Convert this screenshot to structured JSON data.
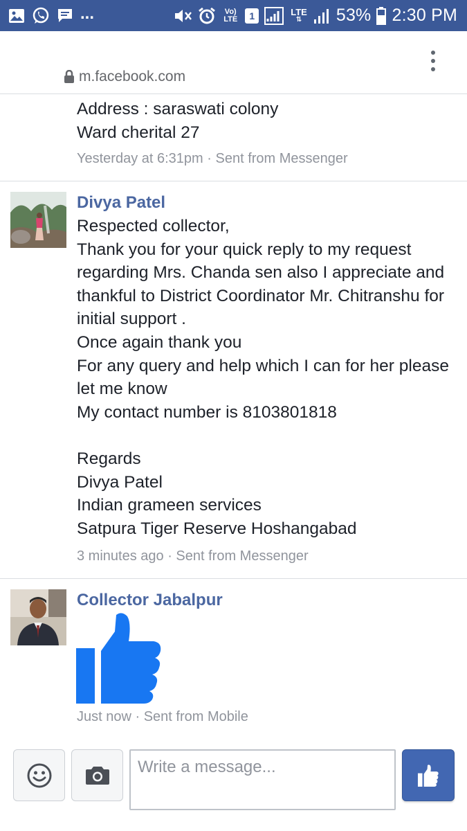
{
  "status_bar": {
    "network_small": "Vo) LTE",
    "sim_slot": "1",
    "lte": "LTE",
    "battery": "53%",
    "time": "2:30 PM"
  },
  "browser": {
    "url": "m.facebook.com"
  },
  "conversation": {
    "messages": [
      {
        "lines": [
          "Address : saraswati colony",
          "Ward cherital 27"
        ],
        "meta": "Yesterday at 6:31pm · Sent from Messenger"
      },
      {
        "sender": "Divya Patel",
        "lines": [
          "Respected collector,",
          "Thank you for your quick reply to my request regarding Mrs. Chanda sen also I appreciate and thankful to District Coordinator Mr. Chitranshu for initial support .",
          "Once again thank you",
          "For any query and help which I can for her please let me know",
          "My contact number is 8103801818",
          "",
          "Regards",
          "Divya Patel",
          "Indian grameen services",
          "Satpura Tiger Reserve Hoshangabad"
        ],
        "meta": "3 minutes ago · Sent from Messenger"
      },
      {
        "sender": "Collector Jabalpur",
        "sticker": "thumbs-up",
        "meta": "Just now · Sent from Mobile"
      }
    ]
  },
  "composer": {
    "placeholder": "Write a message..."
  },
  "colors": {
    "facebook_blue": "#3b5998",
    "name_blue": "#4b67a1",
    "like_blue": "#1877f2",
    "meta_gray": "#90949c"
  },
  "icons": [
    "gallery-icon",
    "whatsapp-icon",
    "chat-bubble-icon",
    "mute-icon",
    "alarm-icon",
    "signal-icon",
    "battery-icon",
    "lock-icon",
    "more-vertical-icon",
    "smiley-icon",
    "camera-icon",
    "thumbs-up-icon"
  ]
}
